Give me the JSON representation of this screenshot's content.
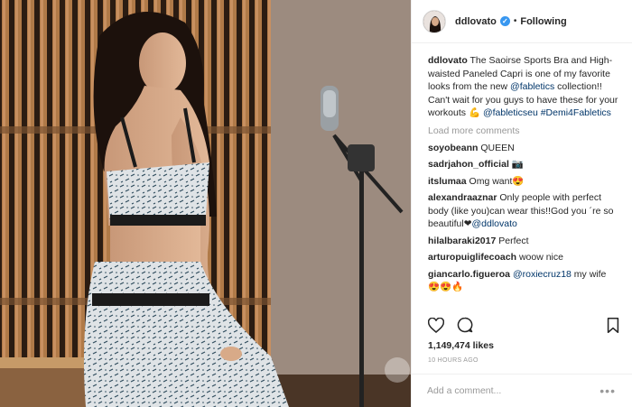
{
  "post": {
    "username": "ddlovato",
    "follow_status": "Following",
    "separator": "•",
    "verified_mark": "✓",
    "caption": {
      "username": "ddlovato",
      "text_1": "The Saoirse Sports Bra and High-waisted Paneled Capri is one of my favorite looks from the new ",
      "mention_1": "@fabletics",
      "text_2": " collection!! Can't wait for you guys to have these for your workouts ",
      "emoji": "💪",
      "mention_2": "@fableticseu",
      "hashtag": "#Demi4Fabletics"
    },
    "load_more": "Load more comments",
    "comments": [
      {
        "user": "soyobeann",
        "text": "QUEEN"
      },
      {
        "user": "sadrjahon_official",
        "text": "📷"
      },
      {
        "user": "itslumaa",
        "text": "Omg want😍"
      },
      {
        "user": "alexandraaznar",
        "text": "Only people with perfect body (like you)can wear this!!God you ´re so beautiful❤",
        "mention": "@ddlovato"
      },
      {
        "user": "hilalbaraki2017",
        "text": "Perfect"
      },
      {
        "user": "arturopuiglifecoach",
        "text": "woow nice"
      },
      {
        "user": "giancarlo.figueroa",
        "mention": "@roxiecruz18",
        "text": " my wife",
        "text_2": "😍😍🔥"
      }
    ],
    "likes": "1,149,474 likes",
    "time": "10 HOURS AGO",
    "add_comment_placeholder": "Add a comment...",
    "more": "•••"
  },
  "icons": {
    "heart": "heart-icon",
    "comment": "comment-icon",
    "bookmark": "bookmark-icon",
    "verified": "verified-icon"
  },
  "colors": {
    "accent": "#3897f0",
    "link": "#003569",
    "muted": "#999999",
    "text": "#262626"
  }
}
